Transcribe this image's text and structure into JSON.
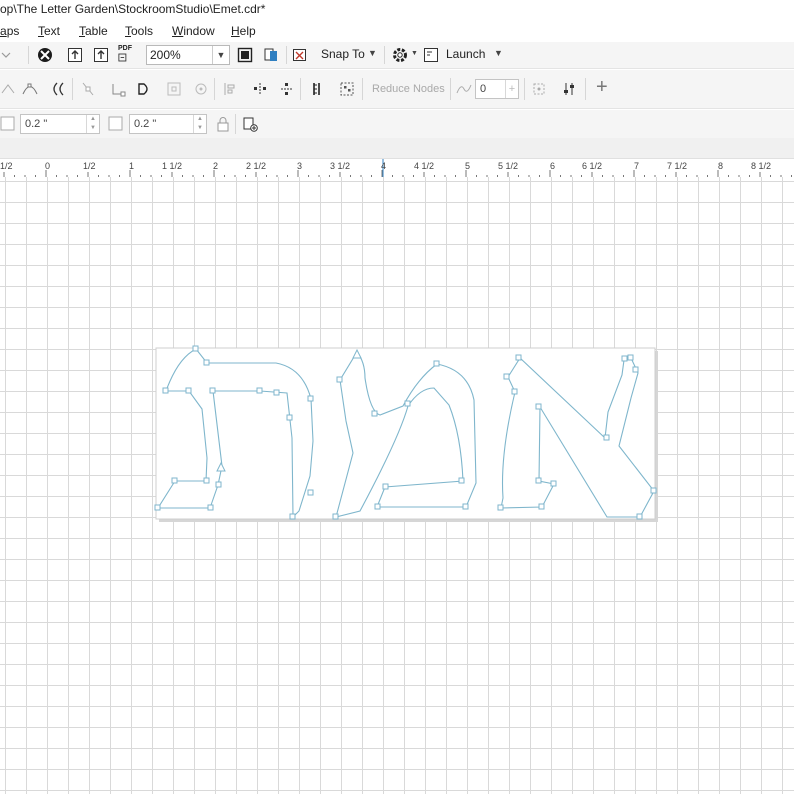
{
  "window": {
    "title": "op\\The Letter Garden\\StockroomStudio\\Emet.cdr*"
  },
  "menu": [
    "aps",
    "Text",
    "Table",
    "Tools",
    "Window",
    "Help"
  ],
  "toolbar": {
    "zoom": "200%",
    "snap_to": "Snap To",
    "launch": "Launch",
    "pdf_label": "PDF"
  },
  "node_toolbar": {
    "reduce_nodes": "Reduce Nodes",
    "smoothness": "0"
  },
  "property_bar": {
    "outline_width_1": "0.2 \"",
    "outline_width_2": "0.2 \""
  },
  "ruler": {
    "labels": [
      "1/2",
      "0",
      "1/2",
      "1",
      "1 1/2",
      "2",
      "2 1/2",
      "3",
      "3 1/2",
      "4",
      "4 1/2",
      "5",
      "5 1/2",
      "6",
      "6 1/2",
      "7",
      "7 1/2",
      "8",
      "8 1/2"
    ]
  },
  "colors": {
    "path_outline": "#7fb6cc",
    "node_fill": "#ffffff",
    "accent": "#2f7fc1"
  },
  "icons": [
    "cut-icon",
    "upload-icon",
    "export-icon",
    "pdf-icon",
    "fullscreen-icon",
    "transform-icon",
    "snap-icon",
    "gear-icon",
    "launch-icon",
    "pick-icon",
    "lock-icon",
    "wrap-icon"
  ]
}
